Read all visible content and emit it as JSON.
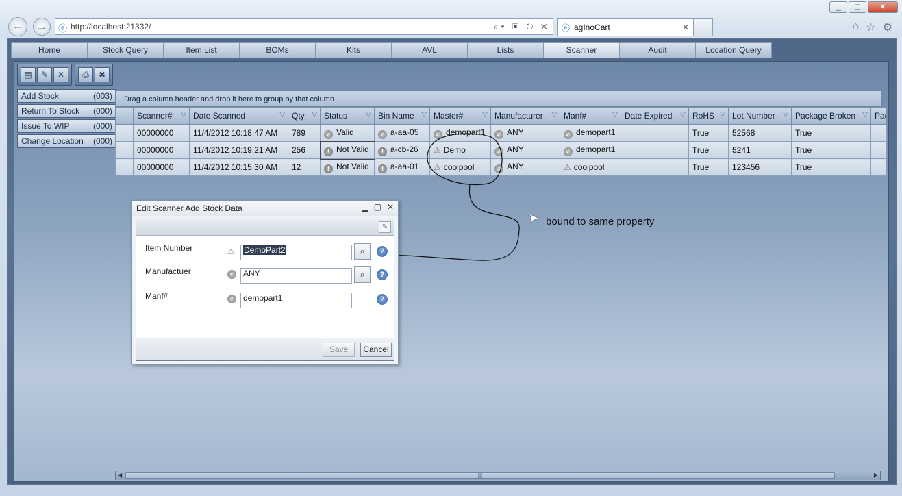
{
  "browser": {
    "url": "http://localhost:21332/",
    "tab_title": "agInoCart"
  },
  "nav": {
    "tabs": [
      "Home",
      "Stock Query",
      "Item List",
      "BOMs",
      "Kits",
      "AVL",
      "Lists",
      "Scanner",
      "Audit",
      "Location Query"
    ],
    "active": "Scanner"
  },
  "left_panel": {
    "items": [
      {
        "label": "Add Stock",
        "count": "(003)"
      },
      {
        "label": "Return To Stock",
        "count": "(000)"
      },
      {
        "label": "Issue To WIP",
        "count": "(000)"
      },
      {
        "label": "Change Location",
        "count": "(000)"
      }
    ]
  },
  "grid": {
    "group_hint": "Drag a column header and drop it here to group by that column",
    "columns": [
      "Scanner#",
      "Date Scanned",
      "Qty",
      "Status",
      "Bin Name",
      "Master#",
      "Manufacturer",
      "Manf#",
      "Date Expired",
      "RoHS",
      "Lot Number",
      "Package Broken",
      "Pac"
    ],
    "rows": [
      {
        "scanner": "00000000",
        "date": "11/4/2012 10:18:47 AM",
        "qty": "789",
        "status": "Valid",
        "bin": "a-aa-05",
        "master": "demopart1",
        "manufacturer": "ANY",
        "manf": "demopart1",
        "expired": "",
        "rohs": "True",
        "lot": "52568",
        "broken": "True"
      },
      {
        "scanner": "00000000",
        "date": "11/4/2012 10:19:21 AM",
        "qty": "256",
        "status": "Not Valid",
        "bin": "a-cb-26",
        "master": "Demo",
        "manufacturer": "ANY",
        "manf": "demopart1",
        "expired": "",
        "rohs": "True",
        "lot": "5241",
        "broken": "True"
      },
      {
        "scanner": "00000000",
        "date": "11/4/2012 10:15:30 AM",
        "qty": "12",
        "status": "Not Valid",
        "bin": "a-aa-01",
        "master": "coolpool",
        "manufacturer": "ANY",
        "manf": "coolpool",
        "expired": "",
        "rohs": "True",
        "lot": "123456",
        "broken": "True"
      }
    ]
  },
  "annotation": {
    "text": "bound to same property"
  },
  "dialog": {
    "title": "Edit Scanner Add Stock Data",
    "fields": [
      {
        "label": "Item Number",
        "value": "DemoPart2"
      },
      {
        "label": "Manufactuer",
        "value": "ANY"
      },
      {
        "label": "Manf#",
        "value": "demopart1"
      }
    ],
    "save_label": "Save",
    "cancel_label": "Cancel"
  }
}
